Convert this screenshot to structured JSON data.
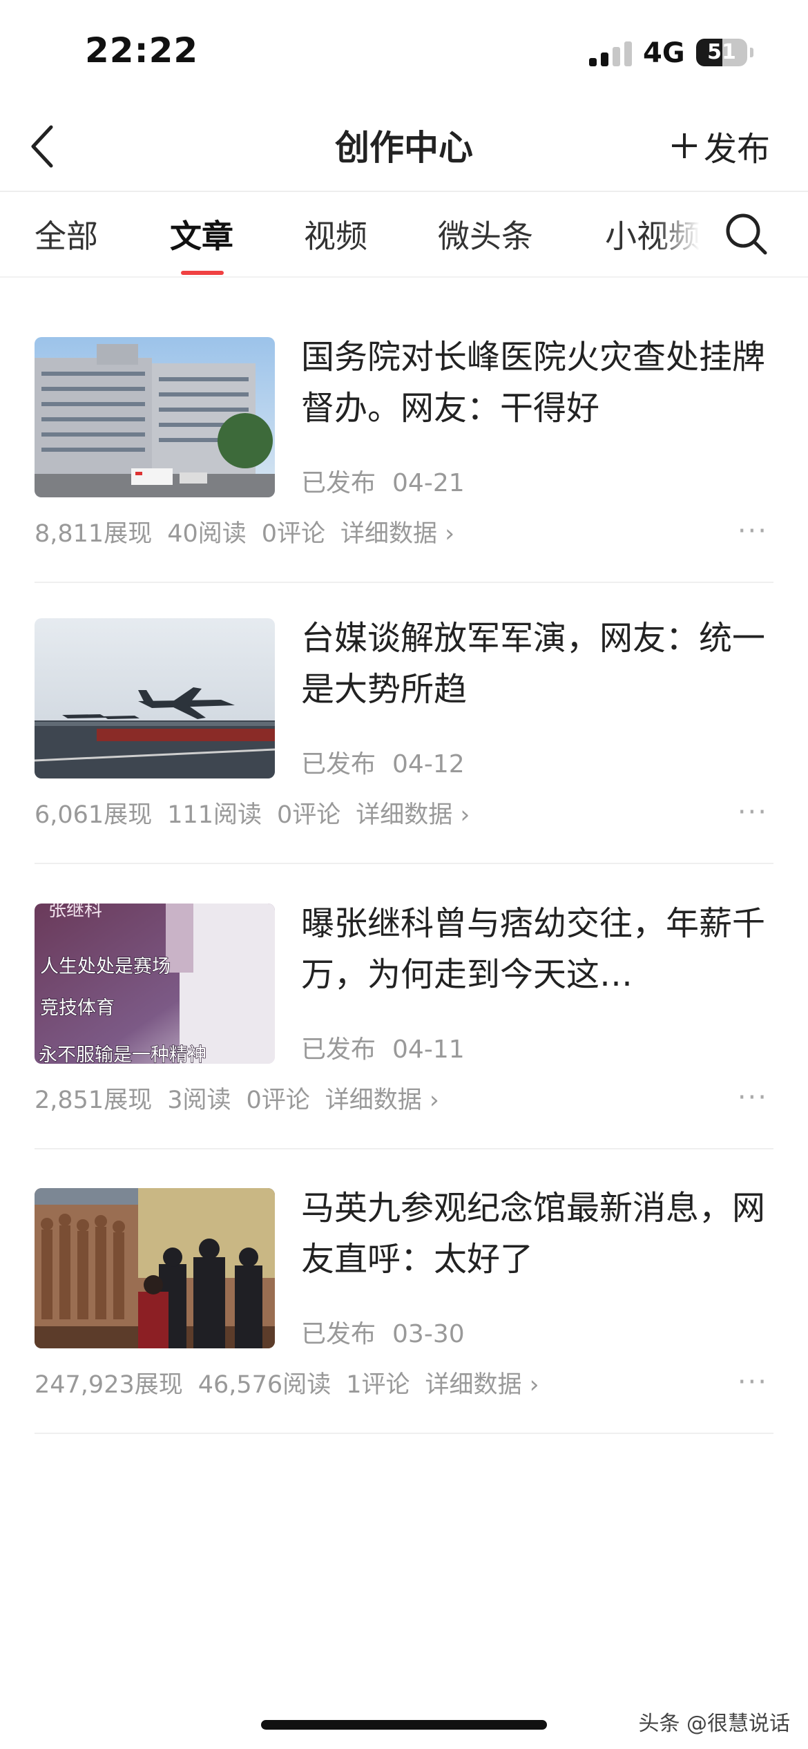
{
  "status_bar": {
    "time": "22:22",
    "network": "4G",
    "battery": "51",
    "battery_level_percent": 51
  },
  "header": {
    "title": "创作中心",
    "publish_label": "发布"
  },
  "tabs": [
    {
      "label": "全部",
      "active": false
    },
    {
      "label": "文章",
      "active": true
    },
    {
      "label": "视频",
      "active": false
    },
    {
      "label": "微头条",
      "active": false
    },
    {
      "label": "小视频",
      "active": false
    }
  ],
  "articles": [
    {
      "title": "国务院对长峰医院火灾查处挂牌督办。网友：干得好",
      "status": "已发布",
      "date": "04-21",
      "impressions": "8,811展现",
      "reads": "40阅读",
      "comments": "0评论",
      "detail": "详细数据 ›"
    },
    {
      "title": "台媒谈解放军军演，网友：统一是大势所趋",
      "status": "已发布",
      "date": "04-12",
      "impressions": "6,061展现",
      "reads": "111阅读",
      "comments": "0评论",
      "detail": "详细数据 ›"
    },
    {
      "title": "曝张继科曾与痞幼交往，年薪千万，为何走到今天这…",
      "status": "已发布",
      "date": "04-11",
      "impressions": "2,851展现",
      "reads": "3阅读",
      "comments": "0评论",
      "detail": "详细数据 ›",
      "thumb_text": {
        "top": "张继科",
        "line1": "人生处处是赛场",
        "line2": "竞技体育",
        "line3": "永不服输是一种精神"
      }
    },
    {
      "title": "马英九参观纪念馆最新消息，网友直呼：太好了",
      "status": "已发布",
      "date": "03-30",
      "impressions": "247,923展现",
      "reads": "46,576阅读",
      "comments": "1评论",
      "detail": "详细数据 ›"
    }
  ],
  "more_icon": "···",
  "watermark": "头条 @很慧说话",
  "colors": {
    "accent": "#f04142",
    "muted_text": "#999999",
    "title_text": "#222222"
  }
}
